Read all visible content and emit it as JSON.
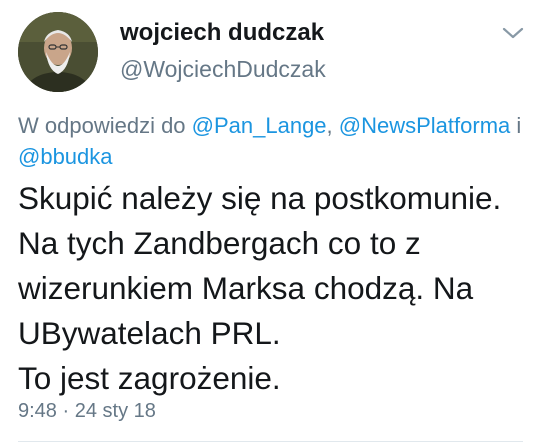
{
  "author": {
    "display_name": "wojciech dudczak",
    "handle": "@WojciechDudczak",
    "avatar_icon": "profile-photo"
  },
  "reply_context": {
    "prefix": "W odpowiedzi do ",
    "mentions": [
      "@Pan_Lange",
      "@NewsPlatforma",
      "@bbudka"
    ],
    "separator": ", ",
    "conjunction": " i "
  },
  "tweet": {
    "lines": [
      "Skupić należy się na postkomunie.",
      "Na tych Zandbergach co to z",
      "wizerunkiem Marksa chodzą. Na",
      "UBywatelach PRL.",
      "To jest zagrożenie."
    ]
  },
  "meta": {
    "time": "9:48",
    "separator": " · ",
    "date": "24 sty 18"
  },
  "menu": {
    "icon": "chevron-down-icon"
  },
  "colors": {
    "text": "#14171a",
    "secondary": "#657786",
    "link": "#1b95e0",
    "divider": "#e1e8ed"
  }
}
